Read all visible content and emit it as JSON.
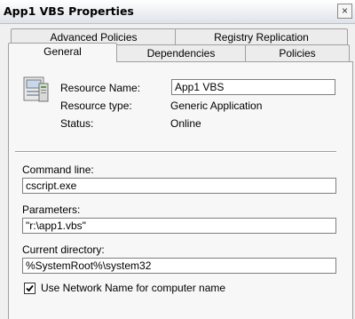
{
  "window": {
    "title": "App1 VBS Properties",
    "close_symbol": "×"
  },
  "tabs": {
    "row1": [
      "Advanced Policies",
      "Registry Replication"
    ],
    "row2": [
      "General",
      "Dependencies",
      "Policies"
    ],
    "selected": "General"
  },
  "general": {
    "icon": "cluster-resource-icon",
    "resource_name_label": "Resource Name:",
    "resource_name_value": "App1 VBS",
    "resource_type_label": "Resource type:",
    "resource_type_value": "Generic Application",
    "status_label": "Status:",
    "status_value": "Online",
    "command_line_label": "Command line:",
    "command_line_value": "cscript.exe",
    "parameters_label": "Parameters:",
    "parameters_value": "\"r:\\app1.vbs\"",
    "current_directory_label": "Current directory:",
    "current_directory_value": "%SystemRoot%\\system32",
    "use_network_name_label": "Use Network Name for computer name",
    "use_network_name_checked": true
  }
}
